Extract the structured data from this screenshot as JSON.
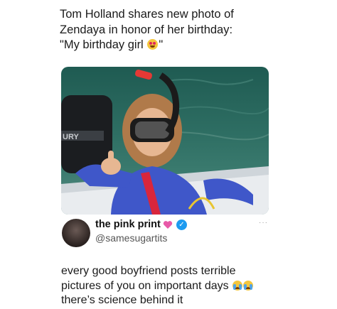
{
  "headline": {
    "line1": "Tom Holland shares new photo of",
    "line2": "Zendaya in honor of her birthday:",
    "line3_prefix": "\"My birthday girl ",
    "line3_suffix": "\"",
    "emoji": "heart-eyes-emoji"
  },
  "photo": {
    "alt_icon": "snorkel-photo",
    "engine_text": "URY"
  },
  "author": {
    "name": "the pink print",
    "handle": "@samesugartits",
    "badge_icon": "verified-icon",
    "heart_icon": "pink-heart-icon",
    "more": "···"
  },
  "tweet": {
    "line1": "every good boyfriend posts terrible",
    "line2": "pictures of you on important days ",
    "line3": "there’s science behind it",
    "emoji": "loudly-crying-emoji"
  },
  "colors": {
    "verified": "#1d9bf0",
    "heart": "#e85aa8",
    "water": "#2e6e63"
  }
}
